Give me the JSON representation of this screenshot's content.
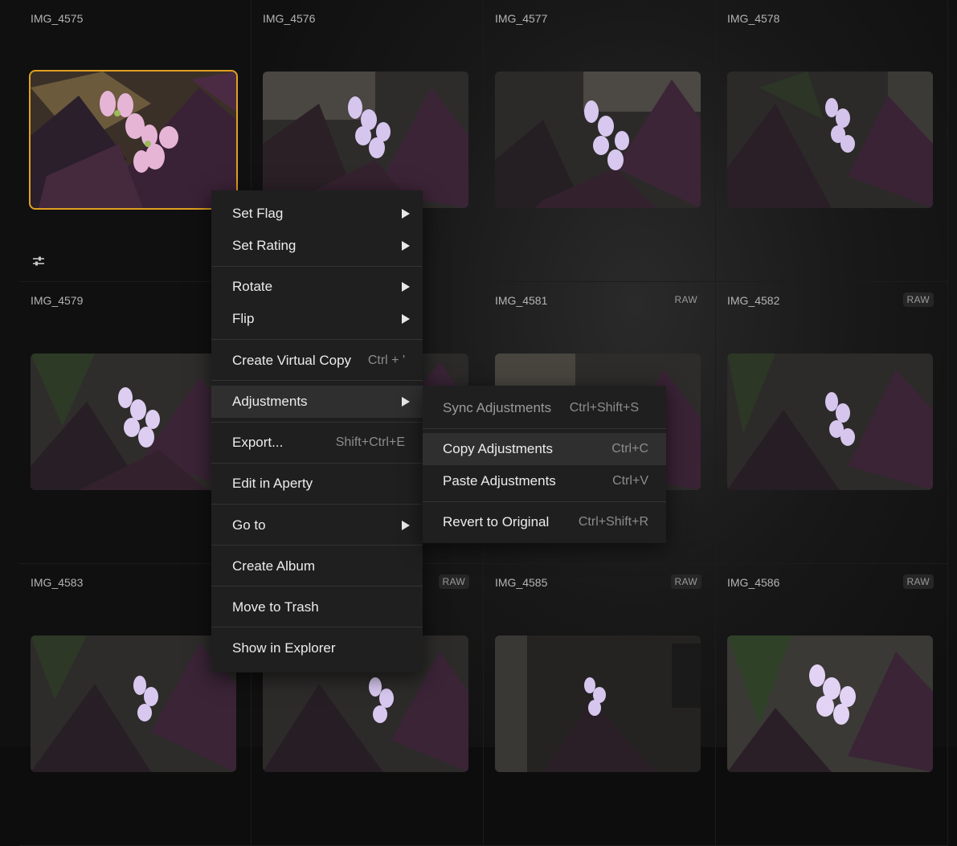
{
  "grid": {
    "thumbnails": [
      {
        "name": "IMG_4575",
        "badge": ""
      },
      {
        "name": "IMG_4576",
        "badge": ""
      },
      {
        "name": "IMG_4577",
        "badge": ""
      },
      {
        "name": "IMG_4578",
        "badge": ""
      },
      {
        "name": "IMG_4579",
        "badge": ""
      },
      {
        "name": "",
        "badge": ""
      },
      {
        "name": "IMG_4581",
        "badge": "RAW"
      },
      {
        "name": "IMG_4582",
        "badge": "RAW"
      },
      {
        "name": "IMG_4583",
        "badge": ""
      },
      {
        "name": "",
        "badge": "RAW"
      },
      {
        "name": "IMG_4585",
        "badge": "RAW"
      },
      {
        "name": "IMG_4586",
        "badge": "RAW"
      }
    ],
    "selected_index": 0,
    "selection_color": "#e0a020"
  },
  "context_menu": {
    "items": [
      {
        "label": "Set Flag",
        "submenu": true,
        "shortcut": ""
      },
      {
        "label": "Set Rating",
        "submenu": true,
        "shortcut": ""
      },
      {
        "label": "Rotate",
        "submenu": true,
        "shortcut": ""
      },
      {
        "label": "Flip",
        "submenu": true,
        "shortcut": ""
      },
      {
        "label": "Create Virtual Copy",
        "submenu": false,
        "shortcut": "Ctrl + '"
      },
      {
        "label": "Adjustments",
        "submenu": true,
        "shortcut": ""
      },
      {
        "label": "Export...",
        "submenu": false,
        "shortcut": "Shift+Ctrl+E"
      },
      {
        "label": "Edit in Aperty",
        "submenu": false,
        "shortcut": ""
      },
      {
        "label": "Go to",
        "submenu": true,
        "shortcut": ""
      },
      {
        "label": "Create Album",
        "submenu": false,
        "shortcut": ""
      },
      {
        "label": "Move to Trash",
        "submenu": false,
        "shortcut": ""
      },
      {
        "label": "Show in Explorer",
        "submenu": false,
        "shortcut": ""
      }
    ],
    "active_item": "Adjustments"
  },
  "adjustments_submenu": {
    "items": [
      {
        "label": "Sync Adjustments",
        "shortcut": "Ctrl+Shift+S",
        "disabled": true
      },
      {
        "label": "Copy Adjustments",
        "shortcut": "Ctrl+C",
        "disabled": false
      },
      {
        "label": "Paste Adjustments",
        "shortcut": "Ctrl+V",
        "disabled": false
      },
      {
        "label": "Revert to Original",
        "shortcut": "Ctrl+Shift+R",
        "disabled": false
      }
    ],
    "hovered_item": "Copy Adjustments"
  },
  "icons": {
    "adjustments_indicator": "sliders-icon",
    "submenu_arrow": "triangle-right-icon"
  }
}
